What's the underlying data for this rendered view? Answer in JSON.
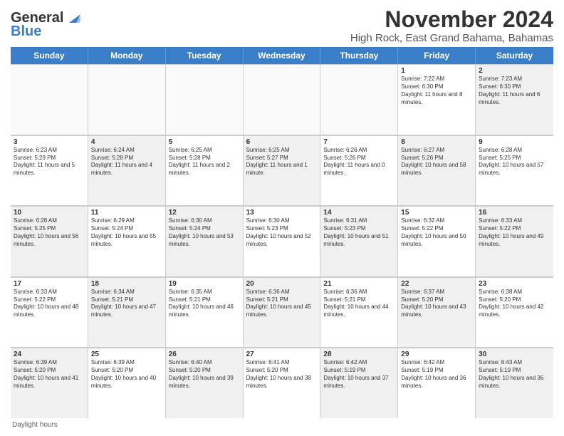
{
  "header": {
    "logo_line1": "General",
    "logo_line2": "Blue",
    "title": "November 2024",
    "subtitle": "High Rock, East Grand Bahama, Bahamas"
  },
  "days_of_week": [
    "Sunday",
    "Monday",
    "Tuesday",
    "Wednesday",
    "Thursday",
    "Friday",
    "Saturday"
  ],
  "weeks": [
    [
      {
        "day": "",
        "info": "",
        "empty": true
      },
      {
        "day": "",
        "info": "",
        "empty": true
      },
      {
        "day": "",
        "info": "",
        "empty": true
      },
      {
        "day": "",
        "info": "",
        "empty": true
      },
      {
        "day": "",
        "info": "",
        "empty": true
      },
      {
        "day": "1",
        "info": "Sunrise: 7:22 AM\nSunset: 6:30 PM\nDaylight: 11 hours and 8 minutes.",
        "empty": false,
        "shaded": false
      },
      {
        "day": "2",
        "info": "Sunrise: 7:23 AM\nSunset: 6:30 PM\nDaylight: 11 hours and 6 minutes.",
        "empty": false,
        "shaded": true
      }
    ],
    [
      {
        "day": "3",
        "info": "Sunrise: 6:23 AM\nSunset: 5:29 PM\nDaylight: 11 hours and 5 minutes.",
        "empty": false,
        "shaded": false
      },
      {
        "day": "4",
        "info": "Sunrise: 6:24 AM\nSunset: 5:28 PM\nDaylight: 11 hours and 4 minutes.",
        "empty": false,
        "shaded": true
      },
      {
        "day": "5",
        "info": "Sunrise: 6:25 AM\nSunset: 5:28 PM\nDaylight: 11 hours and 2 minutes.",
        "empty": false,
        "shaded": false
      },
      {
        "day": "6",
        "info": "Sunrise: 6:25 AM\nSunset: 5:27 PM\nDaylight: 11 hours and 1 minute.",
        "empty": false,
        "shaded": true
      },
      {
        "day": "7",
        "info": "Sunrise: 6:26 AM\nSunset: 5:26 PM\nDaylight: 11 hours and 0 minutes.",
        "empty": false,
        "shaded": false
      },
      {
        "day": "8",
        "info": "Sunrise: 6:27 AM\nSunset: 5:26 PM\nDaylight: 10 hours and 58 minutes.",
        "empty": false,
        "shaded": true
      },
      {
        "day": "9",
        "info": "Sunrise: 6:28 AM\nSunset: 5:25 PM\nDaylight: 10 hours and 57 minutes.",
        "empty": false,
        "shaded": false
      }
    ],
    [
      {
        "day": "10",
        "info": "Sunrise: 6:28 AM\nSunset: 5:25 PM\nDaylight: 10 hours and 56 minutes.",
        "empty": false,
        "shaded": true
      },
      {
        "day": "11",
        "info": "Sunrise: 6:29 AM\nSunset: 5:24 PM\nDaylight: 10 hours and 55 minutes.",
        "empty": false,
        "shaded": false
      },
      {
        "day": "12",
        "info": "Sunrise: 6:30 AM\nSunset: 5:24 PM\nDaylight: 10 hours and 53 minutes.",
        "empty": false,
        "shaded": true
      },
      {
        "day": "13",
        "info": "Sunrise: 6:30 AM\nSunset: 5:23 PM\nDaylight: 10 hours and 52 minutes.",
        "empty": false,
        "shaded": false
      },
      {
        "day": "14",
        "info": "Sunrise: 6:31 AM\nSunset: 5:23 PM\nDaylight: 10 hours and 51 minutes.",
        "empty": false,
        "shaded": true
      },
      {
        "day": "15",
        "info": "Sunrise: 6:32 AM\nSunset: 5:22 PM\nDaylight: 10 hours and 50 minutes.",
        "empty": false,
        "shaded": false
      },
      {
        "day": "16",
        "info": "Sunrise: 6:33 AM\nSunset: 5:22 PM\nDaylight: 10 hours and 49 minutes.",
        "empty": false,
        "shaded": true
      }
    ],
    [
      {
        "day": "17",
        "info": "Sunrise: 6:33 AM\nSunset: 5:22 PM\nDaylight: 10 hours and 48 minutes.",
        "empty": false,
        "shaded": false
      },
      {
        "day": "18",
        "info": "Sunrise: 6:34 AM\nSunset: 5:21 PM\nDaylight: 10 hours and 47 minutes.",
        "empty": false,
        "shaded": true
      },
      {
        "day": "19",
        "info": "Sunrise: 6:35 AM\nSunset: 5:21 PM\nDaylight: 10 hours and 46 minutes.",
        "empty": false,
        "shaded": false
      },
      {
        "day": "20",
        "info": "Sunrise: 6:36 AM\nSunset: 5:21 PM\nDaylight: 10 hours and 45 minutes.",
        "empty": false,
        "shaded": true
      },
      {
        "day": "21",
        "info": "Sunrise: 6:36 AM\nSunset: 5:21 PM\nDaylight: 10 hours and 44 minutes.",
        "empty": false,
        "shaded": false
      },
      {
        "day": "22",
        "info": "Sunrise: 6:37 AM\nSunset: 5:20 PM\nDaylight: 10 hours and 43 minutes.",
        "empty": false,
        "shaded": true
      },
      {
        "day": "23",
        "info": "Sunrise: 6:38 AM\nSunset: 5:20 PM\nDaylight: 10 hours and 42 minutes.",
        "empty": false,
        "shaded": false
      }
    ],
    [
      {
        "day": "24",
        "info": "Sunrise: 6:39 AM\nSunset: 5:20 PM\nDaylight: 10 hours and 41 minutes.",
        "empty": false,
        "shaded": true
      },
      {
        "day": "25",
        "info": "Sunrise: 6:39 AM\nSunset: 5:20 PM\nDaylight: 10 hours and 40 minutes.",
        "empty": false,
        "shaded": false
      },
      {
        "day": "26",
        "info": "Sunrise: 6:40 AM\nSunset: 5:20 PM\nDaylight: 10 hours and 39 minutes.",
        "empty": false,
        "shaded": true
      },
      {
        "day": "27",
        "info": "Sunrise: 6:41 AM\nSunset: 5:20 PM\nDaylight: 10 hours and 38 minutes.",
        "empty": false,
        "shaded": false
      },
      {
        "day": "28",
        "info": "Sunrise: 6:42 AM\nSunset: 5:19 PM\nDaylight: 10 hours and 37 minutes.",
        "empty": false,
        "shaded": true
      },
      {
        "day": "29",
        "info": "Sunrise: 6:42 AM\nSunset: 5:19 PM\nDaylight: 10 hours and 36 minutes.",
        "empty": false,
        "shaded": false
      },
      {
        "day": "30",
        "info": "Sunrise: 6:43 AM\nSunset: 5:19 PM\nDaylight: 10 hours and 36 minutes.",
        "empty": false,
        "shaded": true
      }
    ]
  ],
  "footer": "Daylight hours"
}
